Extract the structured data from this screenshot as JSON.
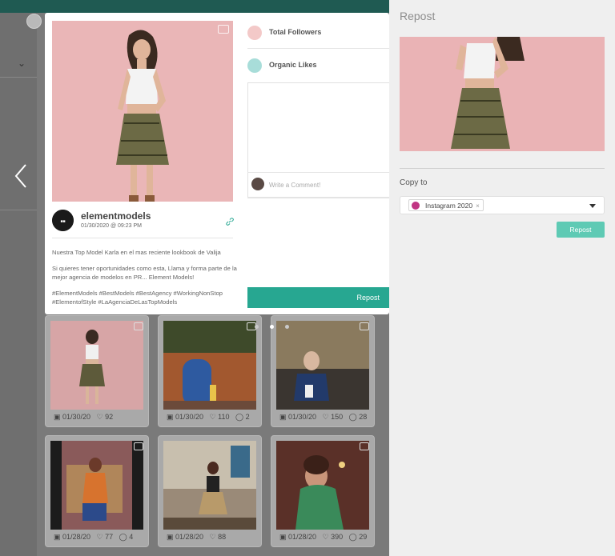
{
  "modal": {
    "username": "elementmodels",
    "date": "01/30/2020 @ 09:23 PM",
    "caption": [
      "Nuestra Top Model Karla en el mas reciente lookbook de Valija",
      "Si quieres tener oportunidades como esta, Llama y forma parte de la mejor agencia de modelos en PR... Element Models!",
      "#ElementModels #BestModels #BestAgency #WorkingNonStop #ElementofStyle #LaAgenciaDeLasTopModels"
    ],
    "metrics": [
      {
        "label": "Total Followers",
        "color": "#f3c9c8"
      },
      {
        "label": "Organic Likes",
        "color": "#a8ddd9"
      }
    ],
    "comment_placeholder": "Write a Comment!",
    "repost_label": "Repost",
    "close_icon": "×"
  },
  "grid": [
    {
      "date": "01/30/20",
      "likes": "92",
      "comments": ""
    },
    {
      "date": "01/30/20",
      "likes": "110",
      "comments": "2"
    },
    {
      "date": "01/30/20",
      "likes": "150",
      "comments": "28"
    },
    {
      "date": "01/28/20",
      "likes": "77",
      "comments": "4"
    },
    {
      "date": "01/28/20",
      "likes": "88",
      "comments": ""
    },
    {
      "date": "01/28/20",
      "likes": "390",
      "comments": "29"
    }
  ],
  "panel": {
    "title": "Repost",
    "copy_to_label": "Copy to",
    "selected_account": "Instagram 2020",
    "chip_remove": "×",
    "repost_label": "Repost"
  },
  "colors": {
    "accent": "#27a791",
    "panel_button": "#5ecab4",
    "topbar": "#1f5a52"
  }
}
